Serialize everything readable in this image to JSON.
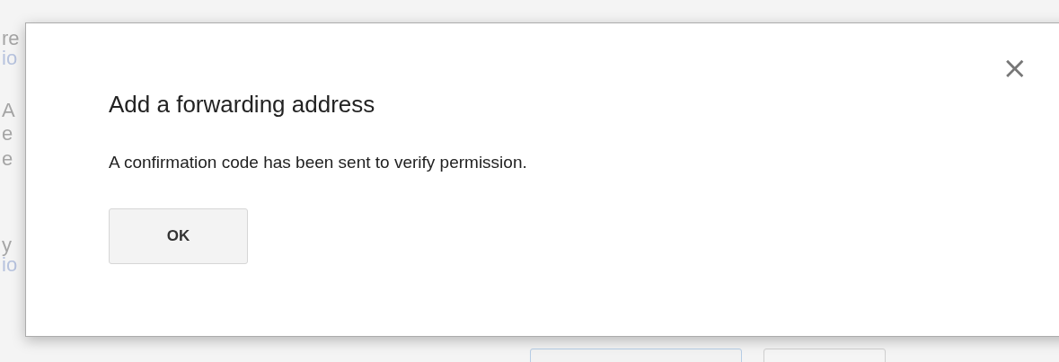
{
  "background_page": {
    "fragments": [
      {
        "text": "re",
        "kind": "text"
      },
      {
        "text": "io",
        "kind": "link"
      },
      {
        "text": "A",
        "kind": "text"
      },
      {
        "text": "e",
        "kind": "text"
      },
      {
        "text": "e",
        "kind": "text"
      },
      {
        "text": "y",
        "kind": "text"
      },
      {
        "text": "io",
        "kind": "link"
      }
    ],
    "buttons": [
      {
        "kind": "primary"
      },
      {
        "kind": "secondary"
      }
    ]
  },
  "dialog": {
    "title": "Add a forwarding address",
    "message": "A confirmation code has been sent to verify permission.",
    "buttons": [
      "OK"
    ],
    "close": "×"
  }
}
